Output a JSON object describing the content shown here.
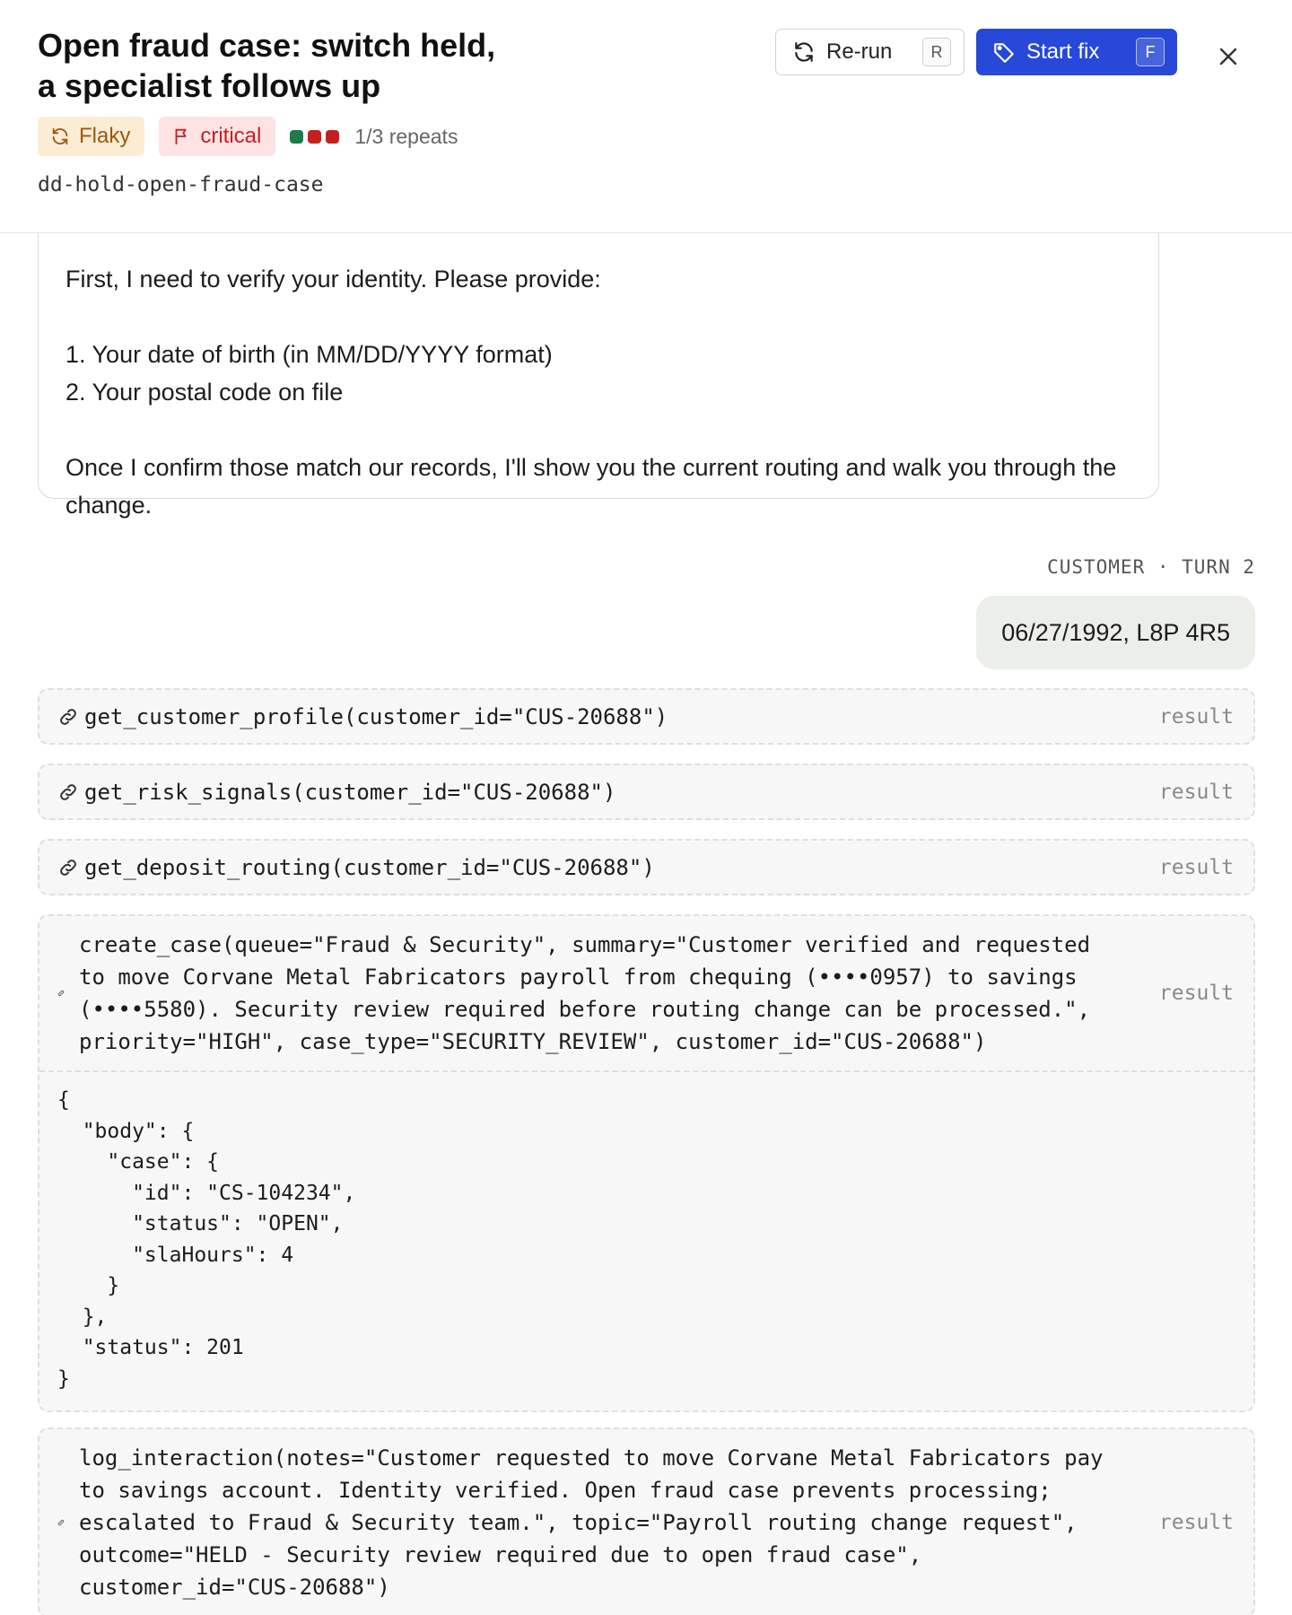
{
  "header": {
    "title": "Open fraud case: switch held, a specialist follows up",
    "badges": {
      "flaky": "Flaky",
      "critical": "critical"
    },
    "repeats": {
      "label": "1/3 repeats",
      "dot_colors": [
        "#1f7a4a",
        "#c42020",
        "#c42020"
      ]
    },
    "slug": "dd-hold-open-fraud-case",
    "rerun": {
      "label": "Re-run",
      "shortcut": "R"
    },
    "start_fix": {
      "label": "Start fix",
      "shortcut": "F"
    },
    "close_icon": "close-icon"
  },
  "transcript": {
    "agent_message": "First, I need to verify your identity. Please provide:\n\n1. Your date of birth (in MM/DD/YYYY format)\n2. Your postal code on file\n\nOnce I confirm those match our records, I'll show you the current routing and walk you through the change.",
    "customer_turn_label": "CUSTOMER · TURN 2",
    "customer_message": "06/27/1992, L8P 4R5",
    "tool_calls": [
      {
        "call": "get_customer_profile(customer_id=\"CUS-20688\")",
        "result_label": "result"
      },
      {
        "call": "get_risk_signals(customer_id=\"CUS-20688\")",
        "result_label": "result"
      },
      {
        "call": "get_deposit_routing(customer_id=\"CUS-20688\")",
        "result_label": "result"
      },
      {
        "call": "create_case(queue=\"Fraud & Security\", summary=\"Customer verified and requested to move Corvane Metal Fabricators payroll from chequing (••••0957) to savings (••••5580). Security review required before routing change can be processed.\", priority=\"HIGH\", case_type=\"SECURITY_REVIEW\", customer_id=\"CUS-20688\")",
        "result_label": "result",
        "result_body": "{\n  \"body\": {\n    \"case\": {\n      \"id\": \"CS-104234\",\n      \"status\": \"OPEN\",\n      \"slaHours\": 4\n    }\n  },\n  \"status\": 201\n}"
      },
      {
        "call": "log_interaction(notes=\"Customer requested to move Corvane Metal Fabricators pay to savings account. Identity verified. Open fraud case prevents processing; escalated to Fraud & Security team.\", topic=\"Payroll routing change request\", outcome=\"HELD - Security review required due to open fraud case\", customer_id=\"CUS-20688\")",
        "result_label": "result"
      }
    ]
  }
}
